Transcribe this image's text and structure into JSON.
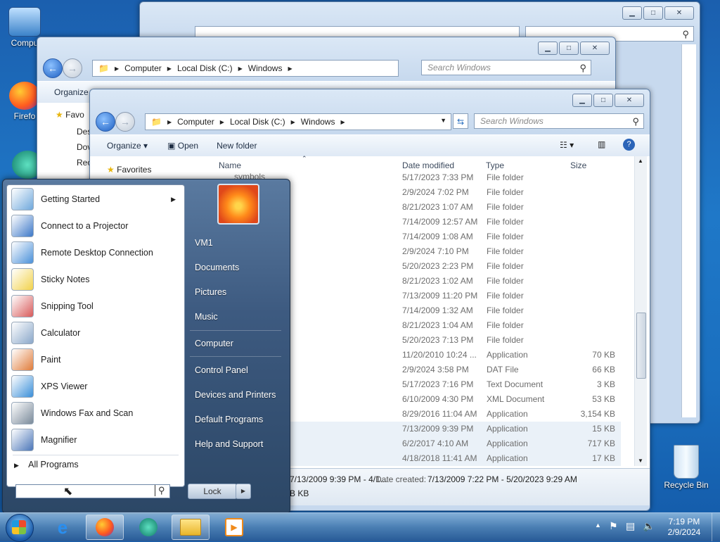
{
  "desktop": {
    "icons": [
      {
        "label": "Compu"
      },
      {
        "label": "Firefo"
      },
      {
        "label": "Recycle Bin"
      }
    ]
  },
  "back_window": {
    "address": {
      "crumbs": [
        "Computer",
        "Local Disk (C:)",
        "Windows"
      ]
    },
    "search_placeholder": "Search Windows",
    "toolbar": {
      "organize": "Organize"
    },
    "nav": {
      "favorites": "Favo",
      "items": [
        "Des",
        "Dov",
        "Rec"
      ]
    }
  },
  "explorer": {
    "address": {
      "crumbs": [
        "Computer",
        "Local Disk (C:)",
        "Windows"
      ]
    },
    "search_placeholder": "Search Windows",
    "toolbar": {
      "organize": "Organize",
      "open": "Open",
      "new_folder": "New folder"
    },
    "nav": {
      "favorites": "Favorites"
    },
    "columns": {
      "name": "Name",
      "date": "Date modified",
      "type": "Type",
      "size": "Size"
    },
    "partial_name": "symbols",
    "rows": [
      {
        "date": "5/17/2023 7:33 PM",
        "type": "File folder",
        "size": ""
      },
      {
        "date": "2/9/2024 7:02 PM",
        "type": "File folder",
        "size": ""
      },
      {
        "date": "8/21/2023 1:07 AM",
        "type": "File folder",
        "size": ""
      },
      {
        "date": "7/14/2009 12:57 AM",
        "type": "File folder",
        "size": ""
      },
      {
        "date": "7/14/2009 1:08 AM",
        "type": "File folder",
        "size": ""
      },
      {
        "date": "2/9/2024 7:10 PM",
        "type": "File folder",
        "size": ""
      },
      {
        "date": "5/20/2023 2:23 PM",
        "type": "File folder",
        "size": ""
      },
      {
        "date": "8/21/2023 1:02 AM",
        "type": "File folder",
        "size": ""
      },
      {
        "date": "7/13/2009 11:20 PM",
        "type": "File folder",
        "size": ""
      },
      {
        "date": "7/14/2009 1:32 AM",
        "type": "File folder",
        "size": ""
      },
      {
        "date": "8/21/2023 1:04 AM",
        "type": "File folder",
        "size": ""
      },
      {
        "date": "5/20/2023 7:13 PM",
        "type": "File folder",
        "size": ""
      },
      {
        "date": "11/20/2010 10:24 ...",
        "type": "Application",
        "size": "70 KB"
      },
      {
        "date": "2/9/2024 3:58 PM",
        "type": "DAT File",
        "size": "66 KB"
      },
      {
        "date": "5/17/2023 7:16 PM",
        "type": "Text Document",
        "size": "3 KB"
      },
      {
        "date": "6/10/2009 4:30 PM",
        "type": "XML Document",
        "size": "53 KB"
      },
      {
        "date": "8/29/2016 11:04 AM",
        "type": "Application",
        "size": "3,154 KB"
      },
      {
        "date": "7/13/2009 9:39 PM",
        "type": "Application",
        "size": "15 KB"
      },
      {
        "date": "6/2/2017 4:10 AM",
        "type": "Application",
        "size": "717 KB"
      },
      {
        "date": "4/18/2018 11:41 AM",
        "type": "Application",
        "size": "17 KB"
      }
    ],
    "details": {
      "date_range": "7/13/2009 9:39 PM - 4/1...",
      "created_label": "Date created:",
      "created_value": "7/13/2009 7:22 PM - 5/20/2023 9:29 AM",
      "size_partial": "B KB"
    }
  },
  "start_menu": {
    "programs": [
      {
        "label": "Getting Started",
        "has_arrow": true
      },
      {
        "label": "Connect to a Projector"
      },
      {
        "label": "Remote Desktop Connection"
      },
      {
        "label": "Sticky Notes"
      },
      {
        "label": "Snipping Tool"
      },
      {
        "label": "Calculator"
      },
      {
        "label": "Paint"
      },
      {
        "label": "XPS Viewer"
      },
      {
        "label": "Windows Fax and Scan"
      },
      {
        "label": "Magnifier"
      }
    ],
    "all_programs": "All Programs",
    "search_value": "",
    "right": [
      "VM1",
      "Documents",
      "Pictures",
      "Music",
      "Computer",
      "Control Panel",
      "Devices and Printers",
      "Default Programs",
      "Help and Support"
    ],
    "lock_label": "Lock"
  },
  "taskbar": {
    "clock_time": "7:19 PM",
    "clock_date": "2/9/2024",
    "colors": {
      "accent": "#1f78c8"
    }
  }
}
